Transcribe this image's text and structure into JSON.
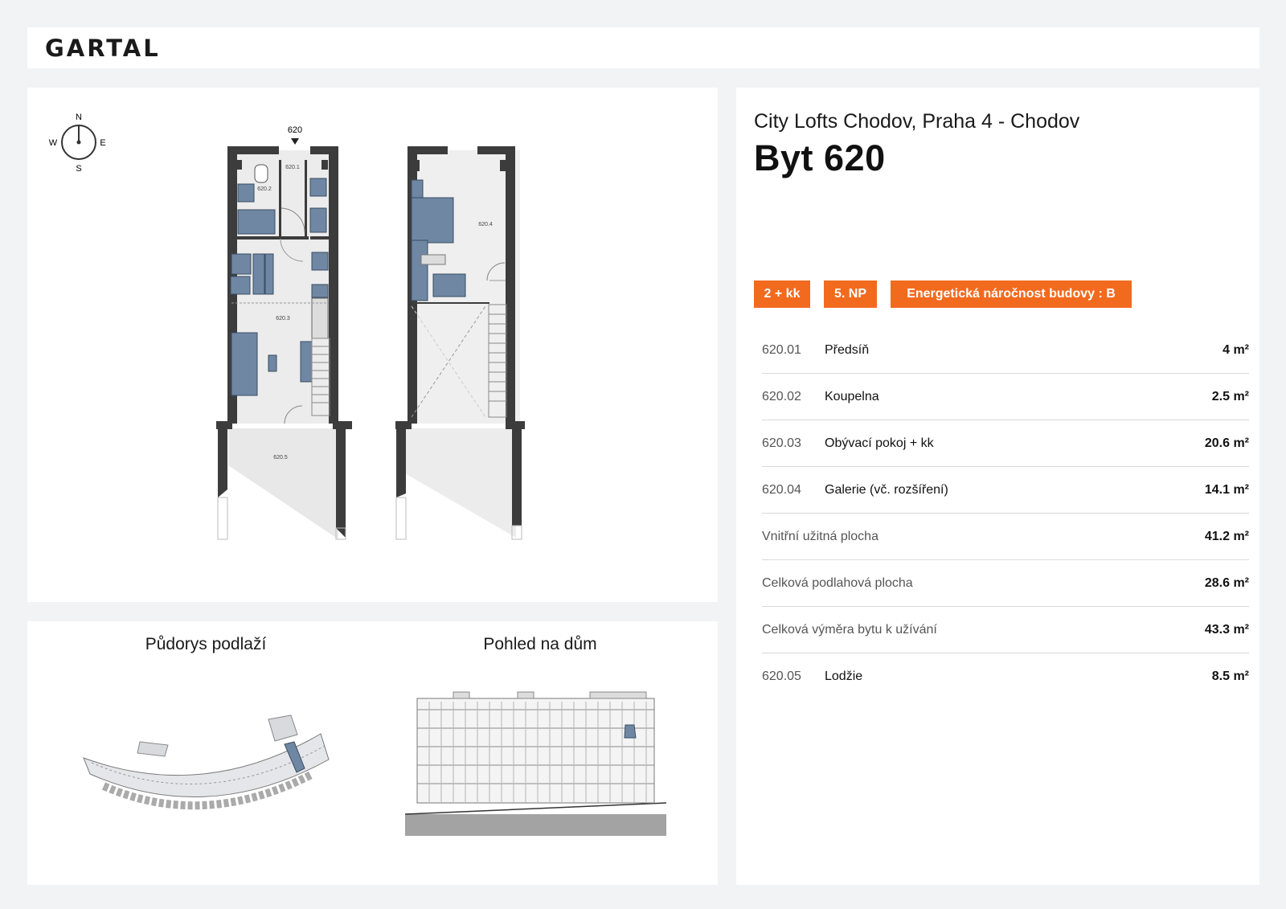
{
  "header": {
    "logo": "GARTAL"
  },
  "plan": {
    "compass": {
      "n": "N",
      "s": "S",
      "e": "E",
      "w": "W"
    },
    "unit_marker": "620",
    "rooms": [
      "620.1",
      "620.2",
      "620.3",
      "620.4",
      "620.5"
    ]
  },
  "mini": {
    "floor_title": "Půdorys podlaží",
    "view_title": "Pohled na dům"
  },
  "info": {
    "project": "City Lofts Chodov, Praha 4 - Chodov",
    "unit_title": "Byt 620",
    "badges": [
      "2 + kk",
      "5. NP",
      "Energetická náročnost budovy : B"
    ],
    "rows": [
      {
        "code": "620.01",
        "name": "Předsíň",
        "value": "4 m²"
      },
      {
        "code": "620.02",
        "name": "Koupelna",
        "value": "2.5 m²"
      },
      {
        "code": "620.03",
        "name": "Obývací pokoj + kk",
        "value": "20.6 m²"
      },
      {
        "code": "620.04",
        "name": "Galerie (vč. rozšíření)",
        "value": "14.1 m²"
      },
      {
        "label": "Vnitřní užitná plocha",
        "value": "41.2 m²"
      },
      {
        "label": "Celková podlahová plocha",
        "value": "28.6 m²"
      },
      {
        "label": "Celková výměra bytu k užívání",
        "value": "43.3 m²"
      },
      {
        "code": "620.05",
        "name": "Lodžie",
        "value": "8.5 m²"
      }
    ]
  },
  "colors": {
    "accent": "#f26a1e",
    "furniture": "#6f87a3",
    "wall": "#3c3c3c"
  }
}
